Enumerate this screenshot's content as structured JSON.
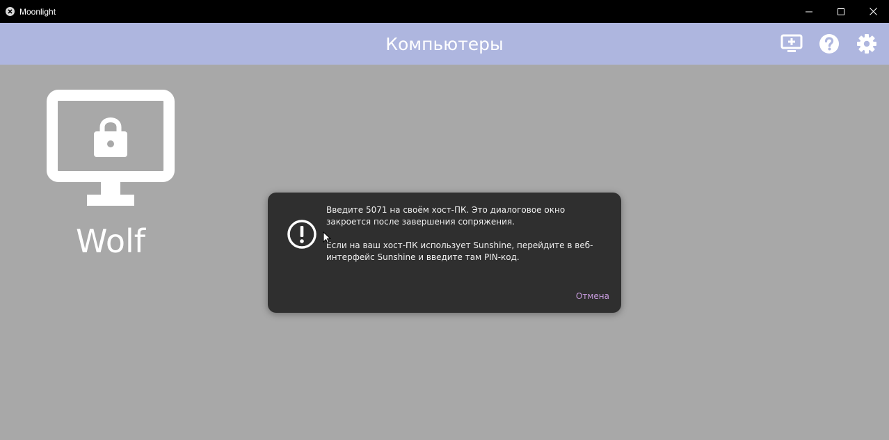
{
  "window": {
    "title": "Moonlight"
  },
  "toolbar": {
    "title": "Компьютеры",
    "icons": [
      "add-pc-icon",
      "help-icon",
      "settings-icon"
    ]
  },
  "computers": [
    {
      "name": "Wolf",
      "status_icon": "lock-icon"
    }
  ],
  "dialog": {
    "icon": "exclamation-circle-icon",
    "message_line1": "Введите 5071 на своём хост-ПК. Это диалоговое окно закроется после завершения сопряжения.",
    "message_line2": "Если на ваш хост-ПК использует Sunshine, перейдите в веб-интерфейс Sunshine и введите там PIN-код.",
    "cancel_label": "Отмена"
  },
  "colors": {
    "titlebar": "#000000",
    "toolbar": "#aeb6df",
    "background": "#a8a8a8",
    "dialog": "#2f2f2f",
    "accent": "#c89cde"
  }
}
